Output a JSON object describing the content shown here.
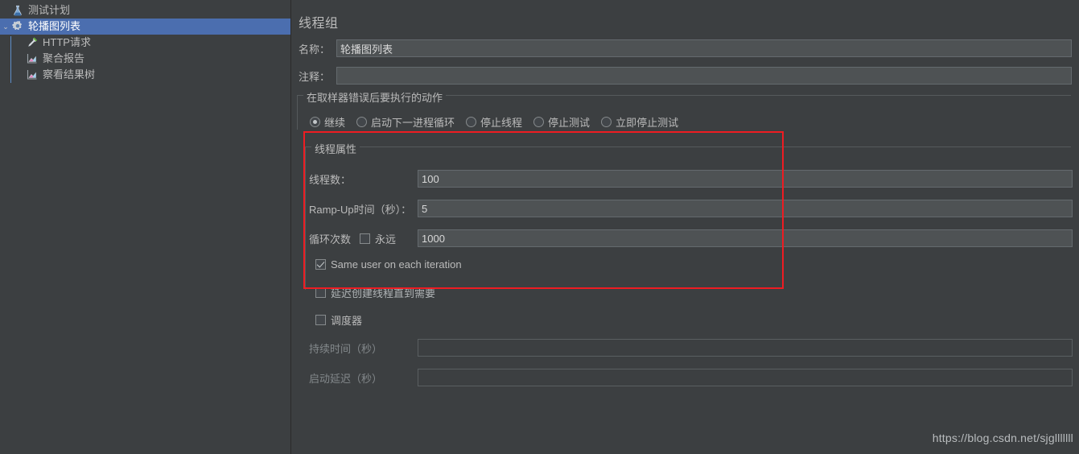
{
  "tree": {
    "items": [
      {
        "label": "测试计划",
        "icon": "flask-icon",
        "depth": 0,
        "selected": false,
        "expanded": null
      },
      {
        "label": "轮播图列表",
        "icon": "gear-icon",
        "depth": 0,
        "selected": true,
        "expanded": true
      },
      {
        "label": "HTTP请求",
        "icon": "pipette-icon",
        "depth": 1,
        "selected": false,
        "expanded": null
      },
      {
        "label": "聚合报告",
        "icon": "chart-icon",
        "depth": 1,
        "selected": false,
        "expanded": null
      },
      {
        "label": "察看结果树",
        "icon": "chart-icon",
        "depth": 1,
        "selected": false,
        "expanded": null
      }
    ],
    "twisty_expanded": "⌄"
  },
  "panel": {
    "title": "线程组",
    "name_label": "名称：",
    "name_value": "轮播图列表",
    "comment_label": "注释：",
    "comment_value": "",
    "error_action": {
      "group_title": "在取样器错误后要执行的动作",
      "options": [
        {
          "label": "继续",
          "checked": true
        },
        {
          "label": "启动下一进程循环",
          "checked": false
        },
        {
          "label": "停止线程",
          "checked": false
        },
        {
          "label": "停止测试",
          "checked": false
        },
        {
          "label": "立即停止测试",
          "checked": false
        }
      ]
    },
    "thread_props": {
      "group_title": "线程属性",
      "threads_label": "线程数：",
      "threads_value": "100",
      "rampup_label": "Ramp-Up时间（秒）：",
      "rampup_value": "5",
      "loops_label": "循环次数",
      "forever_label": "永远",
      "forever_checked": false,
      "loops_value": "1000",
      "same_user_label": "Same user on each iteration",
      "same_user_checked": true,
      "delayed_label": "延迟创建线程直到需要",
      "delayed_checked": false
    },
    "scheduler": {
      "label": "调度器",
      "checked": false,
      "duration_label": "持续时间（秒）",
      "duration_value": "",
      "startup_delay_label": "启动延迟（秒）",
      "startup_delay_value": ""
    }
  },
  "annotation": {
    "highlight_color": "#ee1c22"
  },
  "watermark": "https://blog.csdn.net/sjglllllll"
}
